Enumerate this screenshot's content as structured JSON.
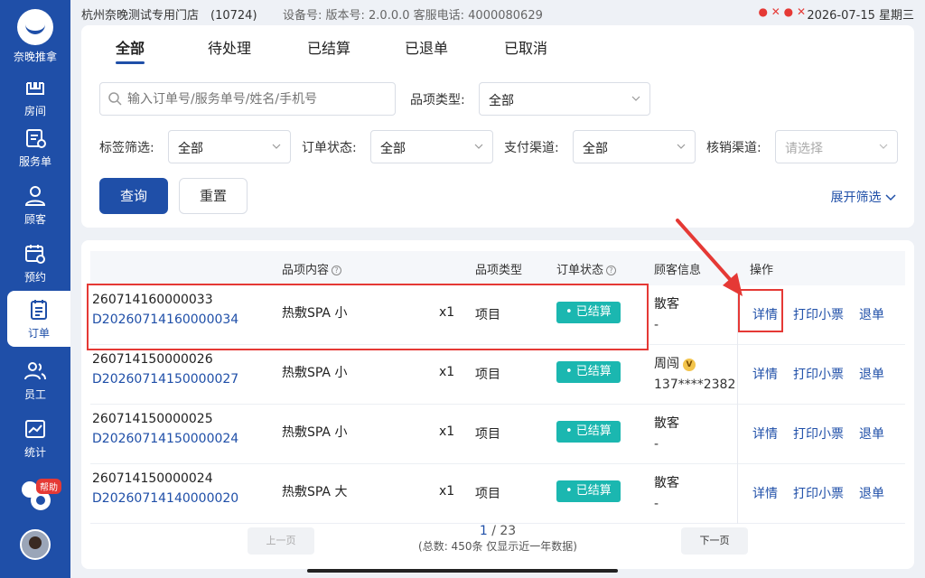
{
  "sidebar": {
    "logo_name": "奈晚推拿",
    "items": [
      {
        "label": "房间",
        "icon": "room-icon"
      },
      {
        "label": "服务单",
        "icon": "service-order-icon"
      },
      {
        "label": "顾客",
        "icon": "customer-icon"
      },
      {
        "label": "预约",
        "icon": "appointment-icon"
      },
      {
        "label": "订单",
        "icon": "order-icon",
        "active": true
      },
      {
        "label": "员工",
        "icon": "staff-icon"
      },
      {
        "label": "统计",
        "icon": "stats-icon"
      }
    ],
    "help_label": "帮助"
  },
  "statusbar": {
    "store": "杭州奈晚测试专用门店",
    "store_id": "(10724)",
    "device": "设备号: 版本号: 2.0.0.0 客服电话: 4000080629",
    "datetime": "2026-07-15 星期三"
  },
  "tabs": [
    "全部",
    "待处理",
    "已结算",
    "已退单",
    "已取消"
  ],
  "filters": {
    "search_placeholder": "输入订单号/服务单号/姓名/手机号",
    "item_type_label": "品项类型:",
    "item_type_value": "全部",
    "tag_label": "标签筛选:",
    "tag_value": "全部",
    "order_status_label": "订单状态:",
    "order_status_value": "全部",
    "pay_channel_label": "支付渠道:",
    "pay_channel_value": "全部",
    "verify_channel_label": "核销渠道:",
    "verify_channel_placeholder": "请选择",
    "query_button": "查询",
    "reset_button": "重置",
    "expand_label": "展开筛选"
  },
  "table": {
    "headers": {
      "item": "品项内容",
      "type": "品项类型",
      "status": "订单状态",
      "customer": "顾客信息",
      "ops": "操作"
    },
    "rows": [
      {
        "order_no": "260714160000033",
        "service_no": "D20260714160000034",
        "item": "热敷SPA 小",
        "qty": "x1",
        "type": "项目",
        "status": "• 已结算",
        "customer": "散客",
        "phone": "-"
      },
      {
        "order_no": "260714150000026",
        "service_no": "D20260714150000027",
        "item": "热敷SPA 小",
        "qty": "x1",
        "type": "项目",
        "status": "• 已结算",
        "customer": "周闯",
        "phone": "137****2382",
        "vip": "V"
      },
      {
        "order_no": "260714150000025",
        "service_no": "D20260714150000024",
        "item": "热敷SPA 小",
        "qty": "x1",
        "type": "项目",
        "status": "• 已结算",
        "customer": "散客",
        "phone": "-"
      },
      {
        "order_no": "260714150000024",
        "service_no": "D20260714140000020",
        "item": "热敷SPA 大",
        "qty": "x1",
        "type": "项目",
        "status": "• 已结算",
        "customer": "散客",
        "phone": "-"
      }
    ],
    "ops": {
      "detail": "详情",
      "print": "打印小票",
      "refund": "退单"
    }
  },
  "pager": {
    "prev": "上一页",
    "next": "下一页",
    "current": "1",
    "total_pages": "/ 23",
    "summary": "(总数: 450条 仅显示近一年数据)"
  },
  "colors": {
    "brand": "#1f4fa8",
    "settled": "#1bb7b0",
    "highlight": "#e53935"
  }
}
